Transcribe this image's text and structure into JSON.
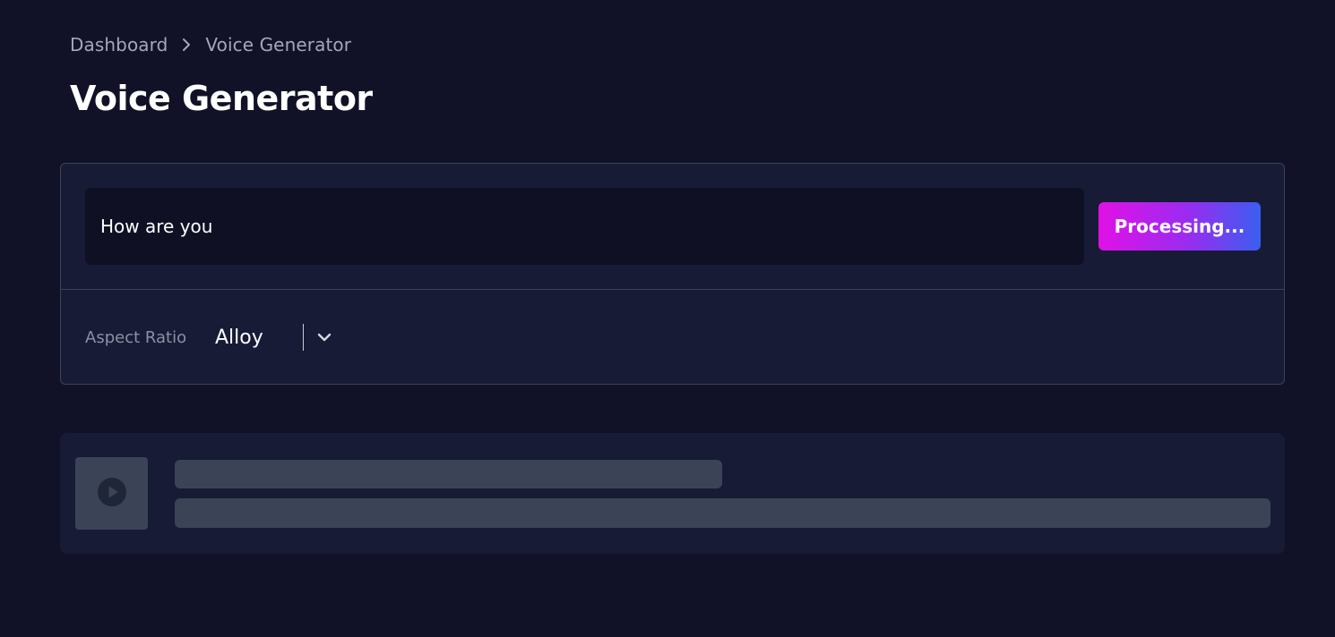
{
  "breadcrumb": {
    "items": [
      "Dashboard",
      "Voice Generator"
    ]
  },
  "header": {
    "title": "Voice Generator"
  },
  "generator": {
    "prompt_value": "How are you",
    "submit_label": "Processing..."
  },
  "options": {
    "aspect_label": "Aspect Ratio",
    "voice_selected": "Alloy"
  },
  "result": {
    "state": "loading",
    "thumbnail_icon": "play-icon"
  },
  "colors": {
    "background": "#111227",
    "card": "#171b36",
    "gradient_start": "#e011e6",
    "gradient_end": "#3a5ef0",
    "skeleton": "#3b4456"
  }
}
